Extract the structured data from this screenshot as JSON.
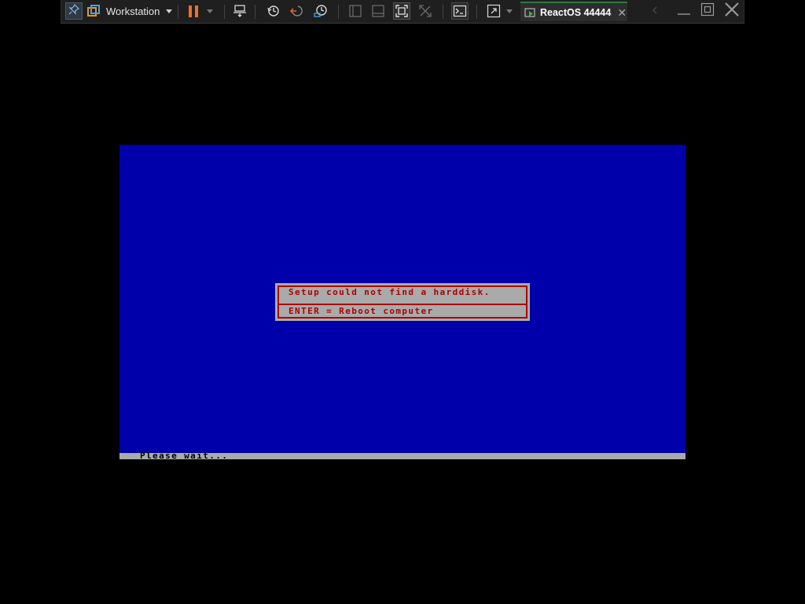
{
  "toolbar": {
    "app_label": "Workstation",
    "vm_tab_label": "ReactOS 44444",
    "tab_close_glyph": "✕",
    "colors": {
      "background": "#1f1f1f",
      "accent_orange": "#f0702a",
      "accent_blue": "#4aa3df"
    },
    "icons": [
      "pin-icon",
      "vmware-logo-icon",
      "pause-icon",
      "send-ctrl-alt-del-icon",
      "snapshot-icon",
      "revert-snapshot-icon",
      "snapshot-manager-icon",
      "console-view-icon",
      "thumbnail-view-icon",
      "full-screen-icon",
      "unity-icon",
      "terminal-icon",
      "stretch-icon",
      "vm-running-icon",
      "minimize-icon",
      "restore-icon",
      "close-window-icon"
    ]
  },
  "guest": {
    "background_color": "#0000aa",
    "dialog": {
      "message": "Setup could not find a harddisk.",
      "hint": "ENTER = Reboot computer",
      "text_color": "#aa0000",
      "background_color": "#aaaaaa"
    },
    "status": "Please wait..."
  }
}
